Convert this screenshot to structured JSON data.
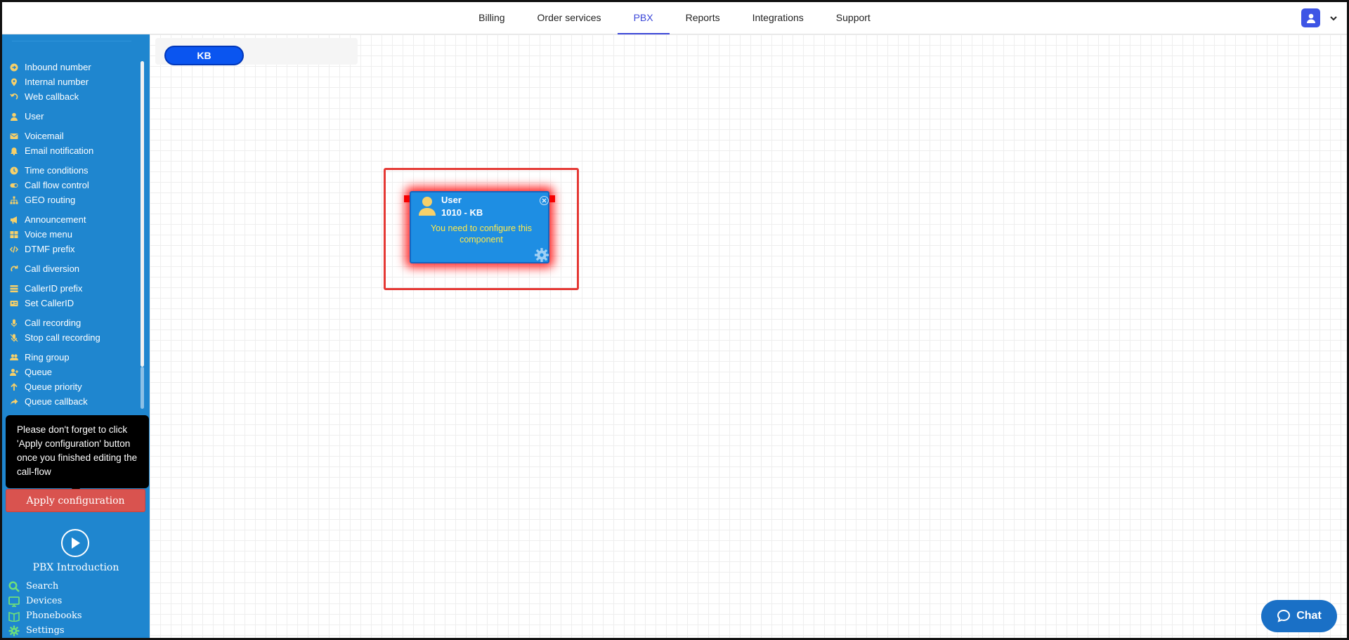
{
  "topnav": {
    "tabs": [
      "Billing",
      "Order services",
      "PBX",
      "Reports",
      "Integrations",
      "Support"
    ],
    "active": "PBX"
  },
  "sidebar": {
    "groups": [
      [
        {
          "label": "Inbound number",
          "icon": "arrow-circle-icon"
        },
        {
          "label": "Internal number",
          "icon": "map-pin-icon"
        },
        {
          "label": "Web callback",
          "icon": "undo-icon"
        }
      ],
      [
        {
          "label": "User",
          "icon": "user-icon"
        }
      ],
      [
        {
          "label": "Voicemail",
          "icon": "envelope-icon"
        },
        {
          "label": "Email notification",
          "icon": "bell-icon"
        }
      ],
      [
        {
          "label": "Time conditions",
          "icon": "clock-icon"
        },
        {
          "label": "Call flow control",
          "icon": "toggle-icon"
        },
        {
          "label": "GEO routing",
          "icon": "sitemap-icon"
        }
      ],
      [
        {
          "label": "Announcement",
          "icon": "megaphone-icon"
        },
        {
          "label": "Voice menu",
          "icon": "grid-icon"
        },
        {
          "label": "DTMF prefix",
          "icon": "code-icon"
        }
      ],
      [
        {
          "label": "Call diversion",
          "icon": "redo-icon"
        }
      ],
      [
        {
          "label": "CallerID prefix",
          "icon": "list-icon"
        },
        {
          "label": "Set CallerID",
          "icon": "id-card-icon"
        }
      ],
      [
        {
          "label": "Call recording",
          "icon": "microphone-icon"
        },
        {
          "label": "Stop call recording",
          "icon": "microphone-slash-icon"
        }
      ],
      [
        {
          "label": "Ring group",
          "icon": "users-icon"
        },
        {
          "label": "Queue",
          "icon": "user-plus-icon"
        },
        {
          "label": "Queue priority",
          "icon": "arrow-up-icon"
        },
        {
          "label": "Queue callback",
          "icon": "share-icon"
        }
      ]
    ],
    "tooltip": "Please don't forget to click 'Apply configuration' button once you finished editing the call-flow",
    "apply_label": "Apply configuration",
    "intro_label": "PBX Introduction",
    "bottom_links": [
      {
        "label": "Search",
        "icon": "search-icon"
      },
      {
        "label": "Devices",
        "icon": "monitor-icon"
      },
      {
        "label": "Phonebooks",
        "icon": "book-icon"
      },
      {
        "label": "Settings",
        "icon": "gear-icon"
      }
    ]
  },
  "canvas": {
    "tag": "KB",
    "node": {
      "type": "User",
      "name": "1010 - KB",
      "warning": "You need to configure this component"
    }
  },
  "chat": {
    "label": "Chat"
  },
  "colors": {
    "sidebar": "#1f86cf",
    "accent": "#3b47d8",
    "apply": "#d9534f",
    "warning": "#ffe94a",
    "node": "#1e8ee3"
  }
}
